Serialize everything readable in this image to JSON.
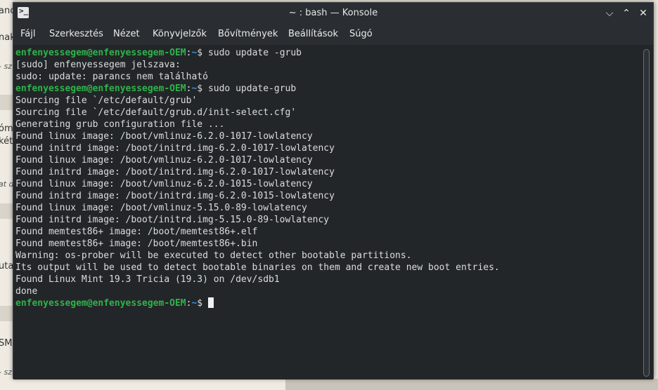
{
  "background_fragments": [
    "anc",
    "nak",
    "- sz",
    "óm",
    "két",
    "at d",
    "uta",
    "SMA",
    "- sz"
  ],
  "window": {
    "title": "~ : bash — Konsole",
    "app_icon": ">_",
    "buttons": {
      "minimize": "⌵",
      "maximize": "⌃",
      "close": "✕"
    }
  },
  "menu": {
    "items": [
      "Fájl",
      "Szerkesztés",
      "Nézet",
      "Könyvjelzők",
      "Bővítmények",
      "Beállítások",
      "Súgó"
    ]
  },
  "terminal": {
    "prompt_user": "enfenyessegem@enfenyessegem-OEM",
    "prompt_path": "~",
    "prompt_symbol": "$",
    "commands": [
      "sudo update -grub",
      "sudo update-grub"
    ],
    "output_1": [
      "[sudo] enfenyessegem jelszava:",
      "sudo: update: parancs nem található"
    ],
    "output_2": [
      "Sourcing file `/etc/default/grub'",
      "Sourcing file `/etc/default/grub.d/init-select.cfg'",
      "Generating grub configuration file ...",
      "Found linux image: /boot/vmlinuz-6.2.0-1017-lowlatency",
      "Found initrd image: /boot/initrd.img-6.2.0-1017-lowlatency",
      "Found linux image: /boot/vmlinuz-6.2.0-1017-lowlatency",
      "Found initrd image: /boot/initrd.img-6.2.0-1017-lowlatency",
      "Found linux image: /boot/vmlinuz-6.2.0-1015-lowlatency",
      "Found initrd image: /boot/initrd.img-6.2.0-1015-lowlatency",
      "Found linux image: /boot/vmlinuz-5.15.0-89-lowlatency",
      "Found initrd image: /boot/initrd.img-5.15.0-89-lowlatency",
      "Found memtest86+ image: /boot/memtest86+.elf",
      "Found memtest86+ image: /boot/memtest86+.bin",
      "Warning: os-prober will be executed to detect other bootable partitions.",
      "Its output will be used to detect bootable binaries on them and create new boot entries.",
      "Found Linux Mint 19.3 Tricia (19.3) on /dev/sdb1",
      "done"
    ]
  },
  "colors": {
    "terminal_bg": "#232629",
    "prompt_user": "#2fb34a",
    "prompt_path": "#3d8fd6",
    "text": "#dcdcdc"
  }
}
